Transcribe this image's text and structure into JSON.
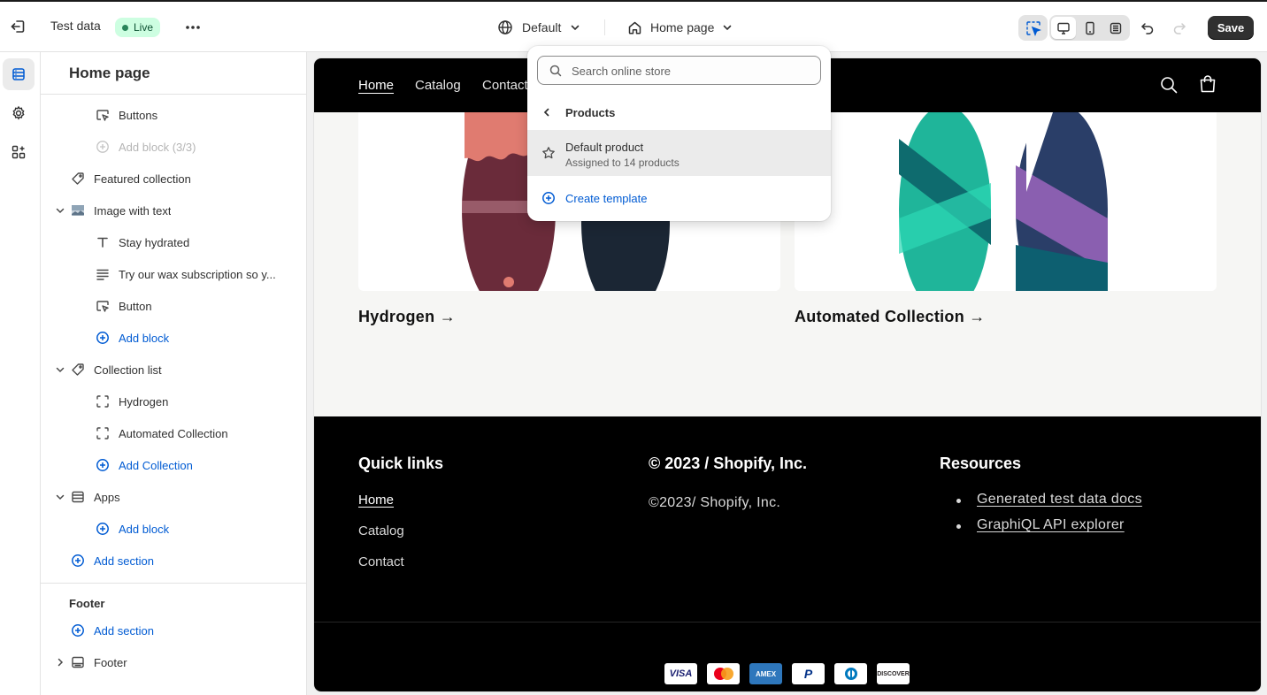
{
  "topbar": {
    "store_name": "Test data",
    "live_badge": "Live",
    "theme_selector": "Default",
    "page_selector": "Home page",
    "save_label": "Save"
  },
  "sidebar": {
    "title": "Home page",
    "rows": [
      {
        "label": "Buttons"
      },
      {
        "label": "Add block (3/3)"
      },
      {
        "label": "Featured collection"
      },
      {
        "label": "Image with text"
      },
      {
        "label": "Stay hydrated"
      },
      {
        "label": "Try our wax subscription so y..."
      },
      {
        "label": "Button"
      },
      {
        "label": "Add block"
      },
      {
        "label": "Collection list"
      },
      {
        "label": "Hydrogen"
      },
      {
        "label": "Automated Collection"
      },
      {
        "label": "Add Collection"
      },
      {
        "label": "Apps"
      },
      {
        "label": "Add block"
      },
      {
        "label": "Add section"
      }
    ],
    "footer_group_title": "Footer",
    "footer_rows": [
      {
        "label": "Add section"
      },
      {
        "label": "Footer"
      }
    ]
  },
  "preview": {
    "nav": [
      "Home",
      "Catalog",
      "Contact"
    ],
    "collections": [
      {
        "title": "Hydrogen →"
      },
      {
        "title": "Automated Collection →"
      }
    ],
    "footer": {
      "quick_links_heading": "Quick links",
      "quick_links": [
        "Home",
        "Catalog",
        "Contact"
      ],
      "copyright_heading": "© 2023 / Shopify, Inc.",
      "copyright_text": "©2023/ Shopify, Inc.",
      "resources_heading": "Resources",
      "resources": [
        "Generated test data docs",
        "GraphiQL API explorer"
      ],
      "payment_icons": [
        "VISA",
        "Mastercard",
        "AMEX",
        "PayPal",
        "Diners Club",
        "DISCOVER"
      ]
    }
  },
  "dropdown": {
    "search_placeholder": "Search online store",
    "back_label": "Products",
    "item_name": "Default product",
    "item_sub": "Assigned to 14 products",
    "create_label": "Create template"
  },
  "colors": {
    "accent_blue": "#005bd3",
    "live_bg": "#cdfee1",
    "live_dot": "#29845a",
    "save_bg": "#303030"
  }
}
